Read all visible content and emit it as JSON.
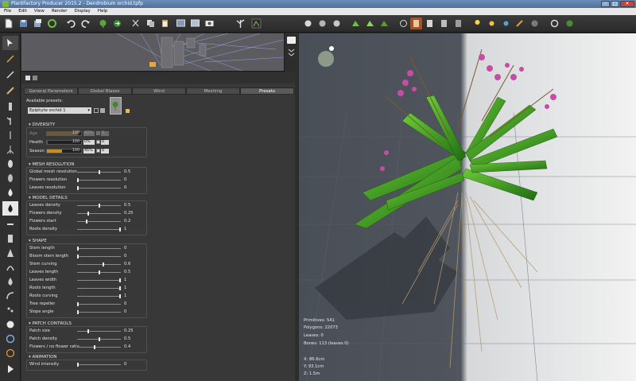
{
  "window": {
    "title": "PlantFactory Producer 2015.2 - Dendrobium orchid.tpfp",
    "min_label": "–",
    "max_label": "□",
    "close_label": "✕"
  },
  "menu": [
    "File",
    "Edit",
    "View",
    "Render",
    "Display",
    "Help"
  ],
  "toolbar_icons": [
    "new-file-icon",
    "save-icon",
    "save-as-icon",
    "recycle-icon",
    "undo-icon",
    "redo-icon",
    "plant-icon",
    "export-icon",
    "cut-icon",
    "copy-icon",
    "paste-icon",
    "graph-view-icon",
    "render-view-icon",
    "screenshot-icon",
    "branch-icon",
    "display-icon"
  ],
  "properties": {
    "tabs": [
      "General Parameters",
      "Global Biases",
      "Wind",
      "Meshing",
      "Presets"
    ],
    "active_tab": "Presets",
    "available_presets_label": "Available presets:",
    "preset_value": "Epiphyte orchid 1",
    "diversity": {
      "title": "DIVERSITY",
      "age": {
        "label": "Age",
        "bar_num": "100",
        "value": "90%",
        "value2": "0"
      },
      "health": {
        "label": "Health",
        "bar_num": "100",
        "value": "0%",
        "value2": "0"
      },
      "season": {
        "label": "Season",
        "bar_num": "100",
        "value": "45%",
        "value2": "0"
      }
    },
    "sections": [
      {
        "id": "mesh",
        "title": "MESH RESOLUTION",
        "rows": [
          {
            "label": "Global mesh resolution",
            "value": "0.5",
            "knob": 0.5
          },
          {
            "label": "Flowers resolution",
            "value": "0",
            "knob": 0
          },
          {
            "label": "Leaves resolution",
            "value": "0",
            "knob": 0
          }
        ]
      },
      {
        "id": "model",
        "title": "MODEL DETAILS",
        "rows": [
          {
            "label": "Leaves density",
            "value": "0.5",
            "knob": 0.5
          },
          {
            "label": "Flowers density",
            "value": "0.25",
            "knob": 0.25
          },
          {
            "label": "Flowers start",
            "value": "0.2",
            "knob": 0.2
          },
          {
            "label": "Roots density",
            "value": "1",
            "knob": 1
          }
        ]
      },
      {
        "id": "shape",
        "title": "SHAPE",
        "rows": [
          {
            "label": "Stem length",
            "value": "0",
            "knob": 0
          },
          {
            "label": "Bloom stem length",
            "value": "0",
            "knob": 0
          },
          {
            "label": "Stem curving",
            "value": "0.6",
            "knob": 0.6
          },
          {
            "label": "Leaves length",
            "value": "0.5",
            "knob": 0.5
          },
          {
            "label": "Leaves width",
            "value": "1",
            "knob": 1
          },
          {
            "label": "Roots length",
            "value": "1",
            "knob": 1
          },
          {
            "label": "Roots curving",
            "value": "1",
            "knob": 1
          },
          {
            "label": "Tree repeller",
            "value": "0",
            "knob": 0
          },
          {
            "label": "Slope angle",
            "value": "0",
            "knob": 0
          }
        ]
      },
      {
        "id": "patch",
        "title": "PATCH CONTROLS",
        "rows": [
          {
            "label": "Patch size",
            "value": "0.25",
            "knob": 0.25
          },
          {
            "label": "Patch density",
            "value": "0.5",
            "knob": 0.5
          },
          {
            "label": "Flowers / no flower ratio",
            "value": "0.4",
            "knob": 0.4
          }
        ]
      },
      {
        "id": "anim",
        "title": "ANIMATION",
        "rows": [
          {
            "label": "Wind intensity",
            "value": "0",
            "knob": 0
          }
        ]
      }
    ]
  },
  "viewport": {
    "stats": {
      "primitives": "Primitives: 541",
      "polygons": "Polygons: 22073",
      "leaves": "Leaves: 0",
      "bones": "Bones: 113 (leaves 0)",
      "x": "X: 86.6cm",
      "y": "Y: 93.1cm",
      "z": "Z: 1.5m"
    }
  }
}
